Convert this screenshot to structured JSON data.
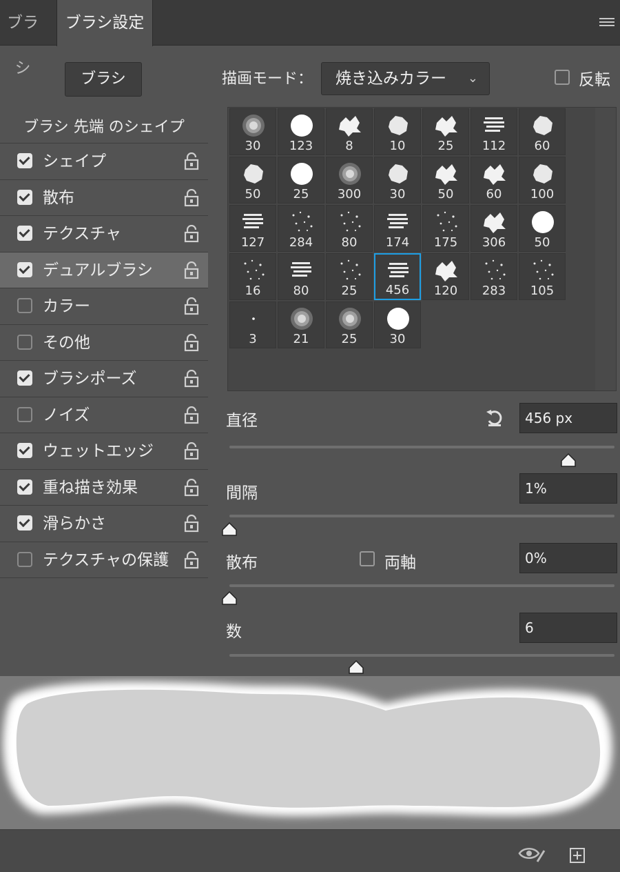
{
  "tabs": [
    {
      "label": "ブラシ",
      "active": false
    },
    {
      "label": "ブラシ設定",
      "active": true
    }
  ],
  "icons": {
    "panel_menu": "hamburger-menu-icon",
    "lock": "lock-icon",
    "reset": "reset-arrow-icon",
    "toggle_preview": "eye-brush-icon",
    "new_preset": "new-preset-icon"
  },
  "brushes_button": "ブラシ",
  "mode": {
    "label": "描画モード：",
    "value": "焼き込みカラー"
  },
  "invert": {
    "label": "反転",
    "checked": false
  },
  "left_header": "ブラシ 先端 のシェイプ",
  "options": [
    {
      "label": "シェイプ",
      "checked": true
    },
    {
      "label": "散布",
      "checked": true
    },
    {
      "label": "テクスチャ",
      "checked": true
    },
    {
      "label": "デュアルブラシ",
      "checked": true,
      "active": true
    },
    {
      "label": "カラー",
      "checked": false
    },
    {
      "label": "その他",
      "checked": false
    },
    {
      "label": "ブラシポーズ",
      "checked": true
    },
    {
      "label": "ノイズ",
      "checked": false
    },
    {
      "label": "ウェットエッジ",
      "checked": true
    },
    {
      "label": "重ね描き効果",
      "checked": true
    },
    {
      "label": "滑らかさ",
      "checked": true
    },
    {
      "label": "テクスチャの保護",
      "checked": false
    }
  ],
  "brush_tips": [
    {
      "size": "30",
      "kind": "soft"
    },
    {
      "size": "123",
      "kind": "hard"
    },
    {
      "size": "8",
      "kind": "splat"
    },
    {
      "size": "10",
      "kind": "rough"
    },
    {
      "size": "25",
      "kind": "splat"
    },
    {
      "size": "112",
      "kind": "speckle"
    },
    {
      "size": "60",
      "kind": "rough"
    },
    {
      "size": "50",
      "kind": "rough"
    },
    {
      "size": "25",
      "kind": "hard"
    },
    {
      "size": "300",
      "kind": "soft"
    },
    {
      "size": "30",
      "kind": "rough"
    },
    {
      "size": "50",
      "kind": "splat"
    },
    {
      "size": "60",
      "kind": "splat"
    },
    {
      "size": "100",
      "kind": "rough"
    },
    {
      "size": "127",
      "kind": "speckle"
    },
    {
      "size": "284",
      "kind": "scatter"
    },
    {
      "size": "80",
      "kind": "scatter"
    },
    {
      "size": "174",
      "kind": "speckle"
    },
    {
      "size": "175",
      "kind": "scatter"
    },
    {
      "size": "306",
      "kind": "splat"
    },
    {
      "size": "50",
      "kind": "hard"
    },
    {
      "size": "16",
      "kind": "scatter"
    },
    {
      "size": "80",
      "kind": "speckle"
    },
    {
      "size": "25",
      "kind": "scatter"
    },
    {
      "size": "456",
      "kind": "speckle",
      "selected": true
    },
    {
      "size": "120",
      "kind": "splat"
    },
    {
      "size": "283",
      "kind": "scatter"
    },
    {
      "size": "105",
      "kind": "scatter"
    },
    {
      "size": "3",
      "kind": "dot"
    },
    {
      "size": "21",
      "kind": "soft"
    },
    {
      "size": "25",
      "kind": "soft"
    },
    {
      "size": "30",
      "kind": "hard"
    }
  ],
  "diameter": {
    "label": "直径",
    "value": "456 px",
    "level": 0.88
  },
  "spacing": {
    "label": "間隔",
    "value": "1%",
    "level": 0.0
  },
  "scatter": {
    "label": "散布",
    "both_axes_label": "両軸",
    "both_axes": false,
    "value": "0%",
    "level": 0.0
  },
  "count": {
    "label": "数",
    "value": "6",
    "level": 0.33
  },
  "colors": {
    "accent": "#1ea0e6",
    "panel": "#535353"
  }
}
